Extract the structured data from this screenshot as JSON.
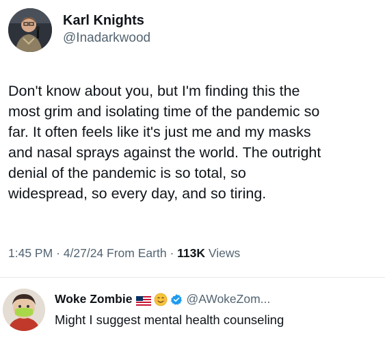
{
  "tweet": {
    "author_name": "Karl Knights",
    "author_handle": "@Inadarkwood",
    "text": "Don't know about you, but I'm finding this the\nmost grim and isolating time of the pandemic so\nfar. It often feels like it's just me and my masks\nand nasal sprays against the world. The outright\ndenial of the pandemic is so total, so\nwidespread, so every day, and so tiring.",
    "time": "1:45 PM",
    "date": "4/27/24",
    "source": "From Earth",
    "views_count": "113K",
    "views_label": "Views",
    "sep": "·"
  },
  "reply": {
    "author_name": "Woke Zombie",
    "author_handle": "@AWokeZom...",
    "text": "Might I suggest mental health counseling"
  },
  "icons": {
    "flag": "us-flag-icon",
    "emoji": "smiling-face-icon",
    "verified": "verified-badge-icon"
  },
  "colors": {
    "text": "#0f1419",
    "secondary": "#536471",
    "verified": "#1d9bf0"
  }
}
